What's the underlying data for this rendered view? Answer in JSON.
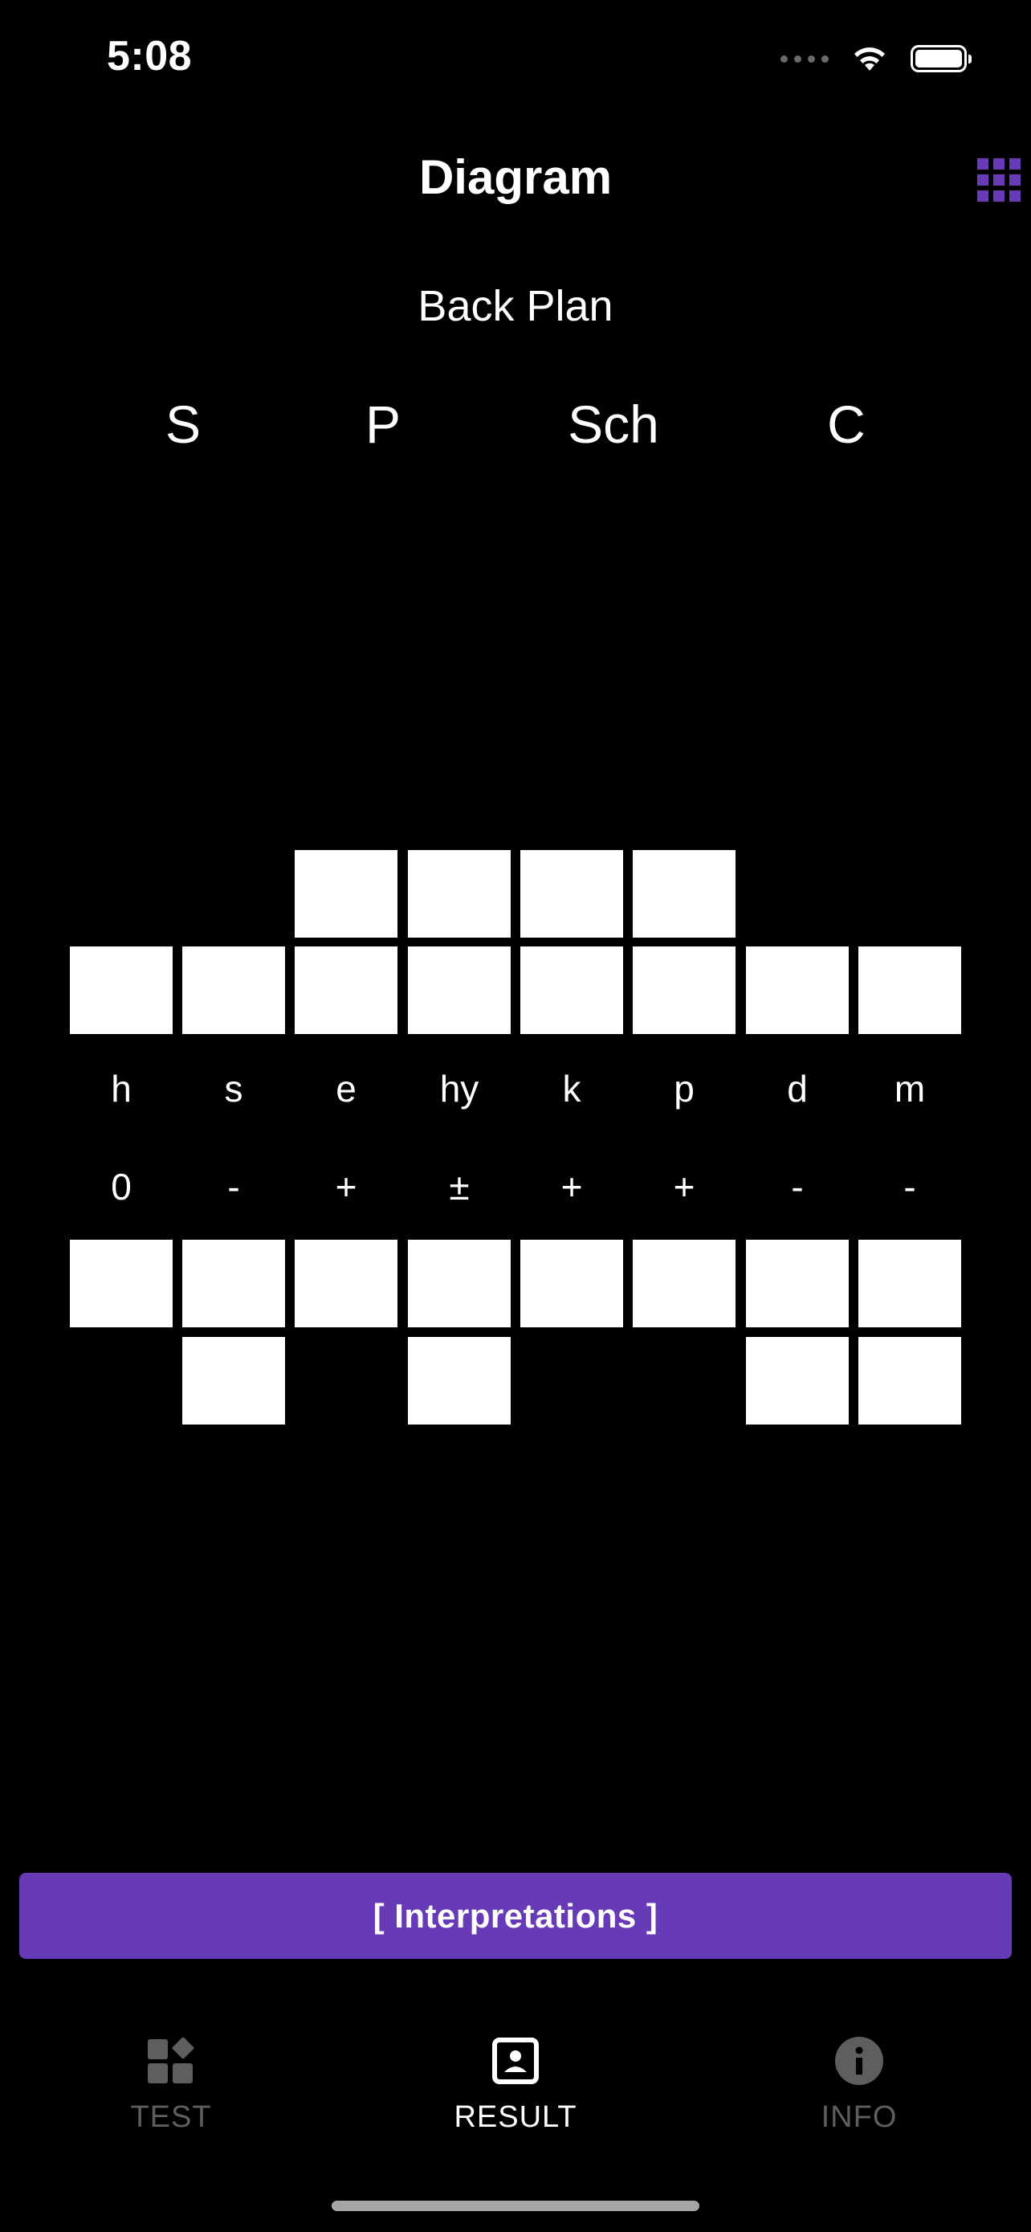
{
  "status_bar": {
    "time": "5:08"
  },
  "header": {
    "title": "Diagram",
    "menu_icon": "grid-icon"
  },
  "subtitle": "Back Plan",
  "columns": [
    "S",
    "P",
    "Sch",
    "C"
  ],
  "diagram": {
    "letters": [
      "h",
      "s",
      "e",
      "hy",
      "k",
      "p",
      "d",
      "m"
    ],
    "signs": [
      "0",
      "-",
      "+",
      "±",
      "+",
      "+",
      "-",
      "-"
    ]
  },
  "interpretations_label": "[ Interpretations ]",
  "tabs": [
    {
      "label": "TEST",
      "icon": "test-icon",
      "active": false
    },
    {
      "label": "RESULT",
      "icon": "result-icon",
      "active": true
    },
    {
      "label": "INFO",
      "icon": "info-icon",
      "active": false
    }
  ],
  "colors": {
    "accent": "#673ab7",
    "background": "#000000",
    "inactive": "#5e5e5e"
  }
}
